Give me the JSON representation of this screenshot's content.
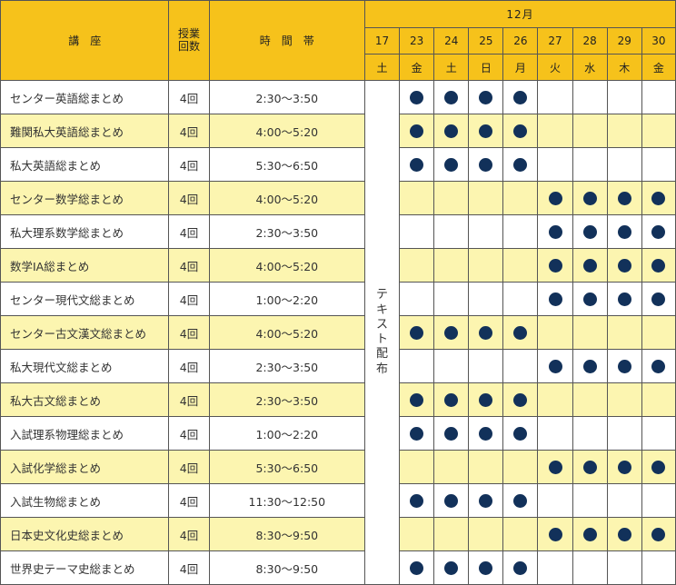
{
  "header": {
    "course": "講　座",
    "count": "授業\n回数",
    "count_line1": "授業",
    "count_line2": "回数",
    "time": "時　間　帯",
    "month": "12月"
  },
  "dates": [
    "17",
    "23",
    "24",
    "25",
    "26",
    "27",
    "28",
    "29",
    "30"
  ],
  "weekdays": [
    "土",
    "金",
    "土",
    "日",
    "月",
    "火",
    "水",
    "木",
    "金"
  ],
  "text_distribution": "テキスト配布",
  "colors": {
    "header": "#f6c21b",
    "row_alt": "#fcf5b0",
    "dot": "#12315a"
  },
  "rows": [
    {
      "course": "センター英語総まとめ",
      "count": "4回",
      "time": "2:30～3:50",
      "marks": [
        1,
        1,
        1,
        1,
        0,
        0,
        0,
        0
      ]
    },
    {
      "course": "難関私大英語総まとめ",
      "count": "4回",
      "time": "4:00～5:20",
      "marks": [
        1,
        1,
        1,
        1,
        0,
        0,
        0,
        0
      ]
    },
    {
      "course": "私大英語総まとめ",
      "count": "4回",
      "time": "5:30～6:50",
      "marks": [
        1,
        1,
        1,
        1,
        0,
        0,
        0,
        0
      ]
    },
    {
      "course": "センター数学総まとめ",
      "count": "4回",
      "time": "4:00～5:20",
      "marks": [
        0,
        0,
        0,
        0,
        1,
        1,
        1,
        1
      ]
    },
    {
      "course": "私大理系数学総まとめ",
      "count": "4回",
      "time": "2:30～3:50",
      "marks": [
        0,
        0,
        0,
        0,
        1,
        1,
        1,
        1
      ]
    },
    {
      "course": "数学ⅠA総まとめ",
      "count": "4回",
      "time": "4:00～5:20",
      "marks": [
        0,
        0,
        0,
        0,
        1,
        1,
        1,
        1
      ]
    },
    {
      "course": "センター現代文総まとめ",
      "count": "4回",
      "time": "1:00～2:20",
      "marks": [
        0,
        0,
        0,
        0,
        1,
        1,
        1,
        1
      ]
    },
    {
      "course": "センター古文漢文総まとめ",
      "count": "4回",
      "time": "4:00～5:20",
      "marks": [
        1,
        1,
        1,
        1,
        0,
        0,
        0,
        0
      ]
    },
    {
      "course": "私大現代文総まとめ",
      "count": "4回",
      "time": "2:30～3:50",
      "marks": [
        0,
        0,
        0,
        0,
        1,
        1,
        1,
        1
      ]
    },
    {
      "course": "私大古文総まとめ",
      "count": "4回",
      "time": "2:30～3:50",
      "marks": [
        1,
        1,
        1,
        1,
        0,
        0,
        0,
        0
      ]
    },
    {
      "course": "入試理系物理総まとめ",
      "count": "4回",
      "time": "1:00～2:20",
      "marks": [
        1,
        1,
        1,
        1,
        0,
        0,
        0,
        0
      ]
    },
    {
      "course": "入試化学総まとめ",
      "count": "4回",
      "time": "5:30～6:50",
      "marks": [
        0,
        0,
        0,
        0,
        1,
        1,
        1,
        1
      ]
    },
    {
      "course": "入試生物総まとめ",
      "count": "4回",
      "time": "11:30～12:50",
      "marks": [
        1,
        1,
        1,
        1,
        0,
        0,
        0,
        0
      ]
    },
    {
      "course": "日本史文化史総まとめ",
      "count": "4回",
      "time": "8:30～9:50",
      "marks": [
        0,
        0,
        0,
        0,
        1,
        1,
        1,
        1
      ]
    },
    {
      "course": "世界史テーマ史総まとめ",
      "count": "4回",
      "time": "8:30～9:50",
      "marks": [
        1,
        1,
        1,
        1,
        0,
        0,
        0,
        0
      ]
    }
  ]
}
